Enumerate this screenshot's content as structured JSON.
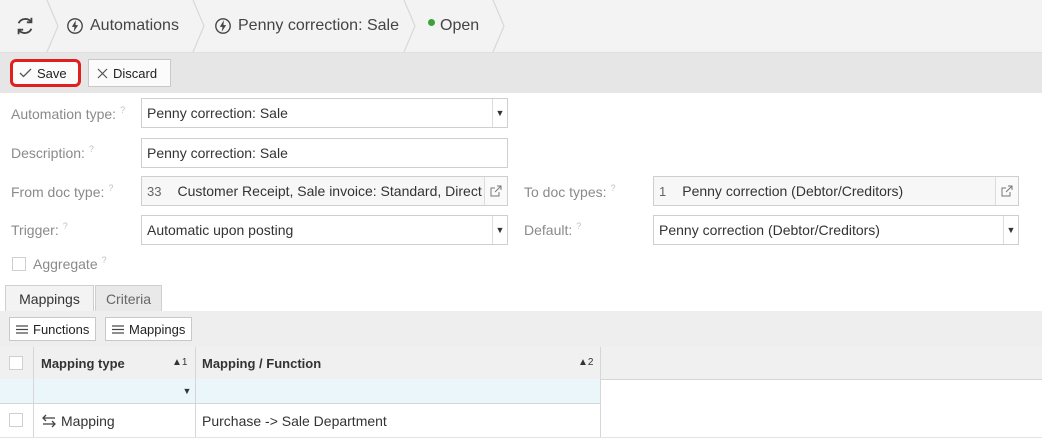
{
  "breadcrumb": {
    "root": "Automations",
    "current": "Penny correction: Sale",
    "status": "Open",
    "status_color": "#3aa23a"
  },
  "toolbar": {
    "save_label": "Save",
    "discard_label": "Discard",
    "save_highlight_color": "#e0201f"
  },
  "form": {
    "automation_type": {
      "label": "Automation type:",
      "value": "Penny correction: Sale"
    },
    "description": {
      "label": "Description:",
      "value": "Penny correction: Sale"
    },
    "from_doc_type": {
      "label": "From doc type:",
      "count": "33",
      "value": "Customer Receipt, Sale invoice: Standard, Direct Re"
    },
    "to_doc_types": {
      "label": "To doc types:",
      "count": "1",
      "value": "Penny correction (Debtor/Creditors)"
    },
    "trigger": {
      "label": "Trigger:",
      "value": "Automatic upon posting"
    },
    "default": {
      "label": "Default:",
      "value": "Penny correction (Debtor/Creditors)"
    },
    "aggregate": {
      "label": "Aggregate",
      "checked": false
    },
    "help_marker": "?"
  },
  "tabs": [
    {
      "label": "Mappings",
      "active": true
    },
    {
      "label": "Criteria",
      "active": false
    }
  ],
  "subtoolbar": {
    "functions_label": "Functions",
    "mappings_label": "Mappings"
  },
  "grid": {
    "columns": [
      {
        "label": "Mapping type",
        "sort": "▲1"
      },
      {
        "label": "Mapping / Function",
        "sort": "▲2"
      }
    ],
    "rows": [
      {
        "type": "Mapping",
        "type_icon": "swap-arrows-icon",
        "value": "Purchase -> Sale Department"
      }
    ]
  }
}
